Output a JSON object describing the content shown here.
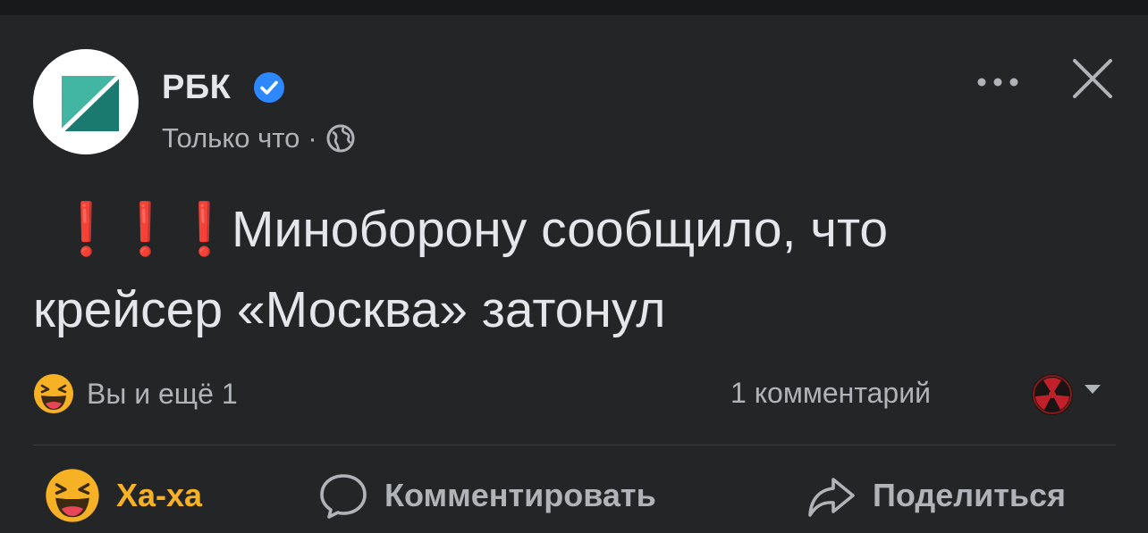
{
  "post": {
    "author": "РБК",
    "verified": true,
    "time": "Только что",
    "separator": "·",
    "privacy_icon": "globe-icon",
    "emoji_prefix": [
      "❗",
      "❗",
      "❗"
    ],
    "text_line1": "Миноборону сообщило, что",
    "text_line2": "крейсер «Москва» затонул"
  },
  "stats": {
    "reaction_icon": "haha-emoji-icon",
    "reactions_text": "Вы и ещё 1",
    "comments_text": "1 комментарий"
  },
  "actions": {
    "haha_label": "Ха-ха",
    "comment_label": "Комментировать",
    "share_label": "Поделиться"
  },
  "colors": {
    "background": "#242527",
    "text": "#e4e6eb",
    "secondary_text": "#b0b3b8",
    "haha_accent": "#f7b125",
    "verified_blue": "#2d88ff",
    "exclamation_red": "#e0252c",
    "logo_teal": "#2a9d8f"
  }
}
